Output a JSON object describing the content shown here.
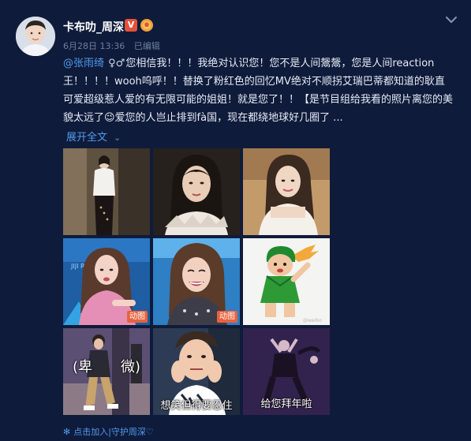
{
  "post": {
    "username": "卡布叻_周深",
    "verified_badge": "V",
    "date": "6月28日 13:36",
    "edited": "已编辑",
    "mention": "@张雨绮",
    "mention_glyph": "♀♂",
    "text": "您相信我！！！我绝对认识您！您不是人间鬶鬶，您是人间reaction王！！！！wooh呜呼！！替换了粉红色的回忆MV绝对不顺拐艾瑞巴蒂都知道的耿直可爱超级惹人爱的有无限可能的姐姐！就是您了！！【是节目组给我看的照片离您的美貌太远了😉爱您的人岂止排到fà国，现在都绕地球好几圈了 ...",
    "expand_label": "展开全文",
    "expand_arrow": "⌄",
    "footer_label": "点击加入|守护周深♡",
    "footer_icon": "flower-icon"
  },
  "images": [
    {
      "name": "photo-1",
      "badge": ""
    },
    {
      "name": "photo-2",
      "badge": ""
    },
    {
      "name": "photo-3",
      "badge": ""
    },
    {
      "name": "photo-4",
      "badge": "动图"
    },
    {
      "name": "photo-5",
      "badge": "动图"
    },
    {
      "name": "photo-6",
      "badge": ""
    },
    {
      "name": "photo-7",
      "caption": "(卑　　微)"
    },
    {
      "name": "photo-8",
      "caption": "想笑但得要忍住"
    },
    {
      "name": "photo-9",
      "caption": "给您拜年啦"
    }
  ],
  "colors": {
    "background": "#0f1b3a",
    "link": "#4f9bf0",
    "gif_badge": "#e8623e"
  }
}
